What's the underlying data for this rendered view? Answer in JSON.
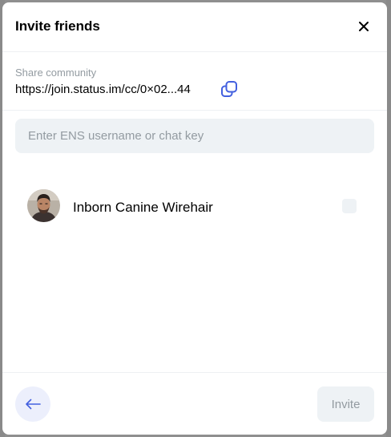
{
  "dialog": {
    "title": "Invite friends"
  },
  "share": {
    "label": "Share community",
    "link": "https://join.status.im/cc/0×02...44"
  },
  "search": {
    "placeholder": "Enter ENS username or chat key",
    "value": ""
  },
  "contacts": [
    {
      "name": "Inborn Canine Wirehair",
      "checked": false
    }
  ],
  "footer": {
    "invite_label": "Invite"
  },
  "colors": {
    "accent": "#4360df",
    "muted_text": "#939ba1",
    "input_bg": "#eef2f5",
    "back_button_bg": "#eceffc"
  }
}
